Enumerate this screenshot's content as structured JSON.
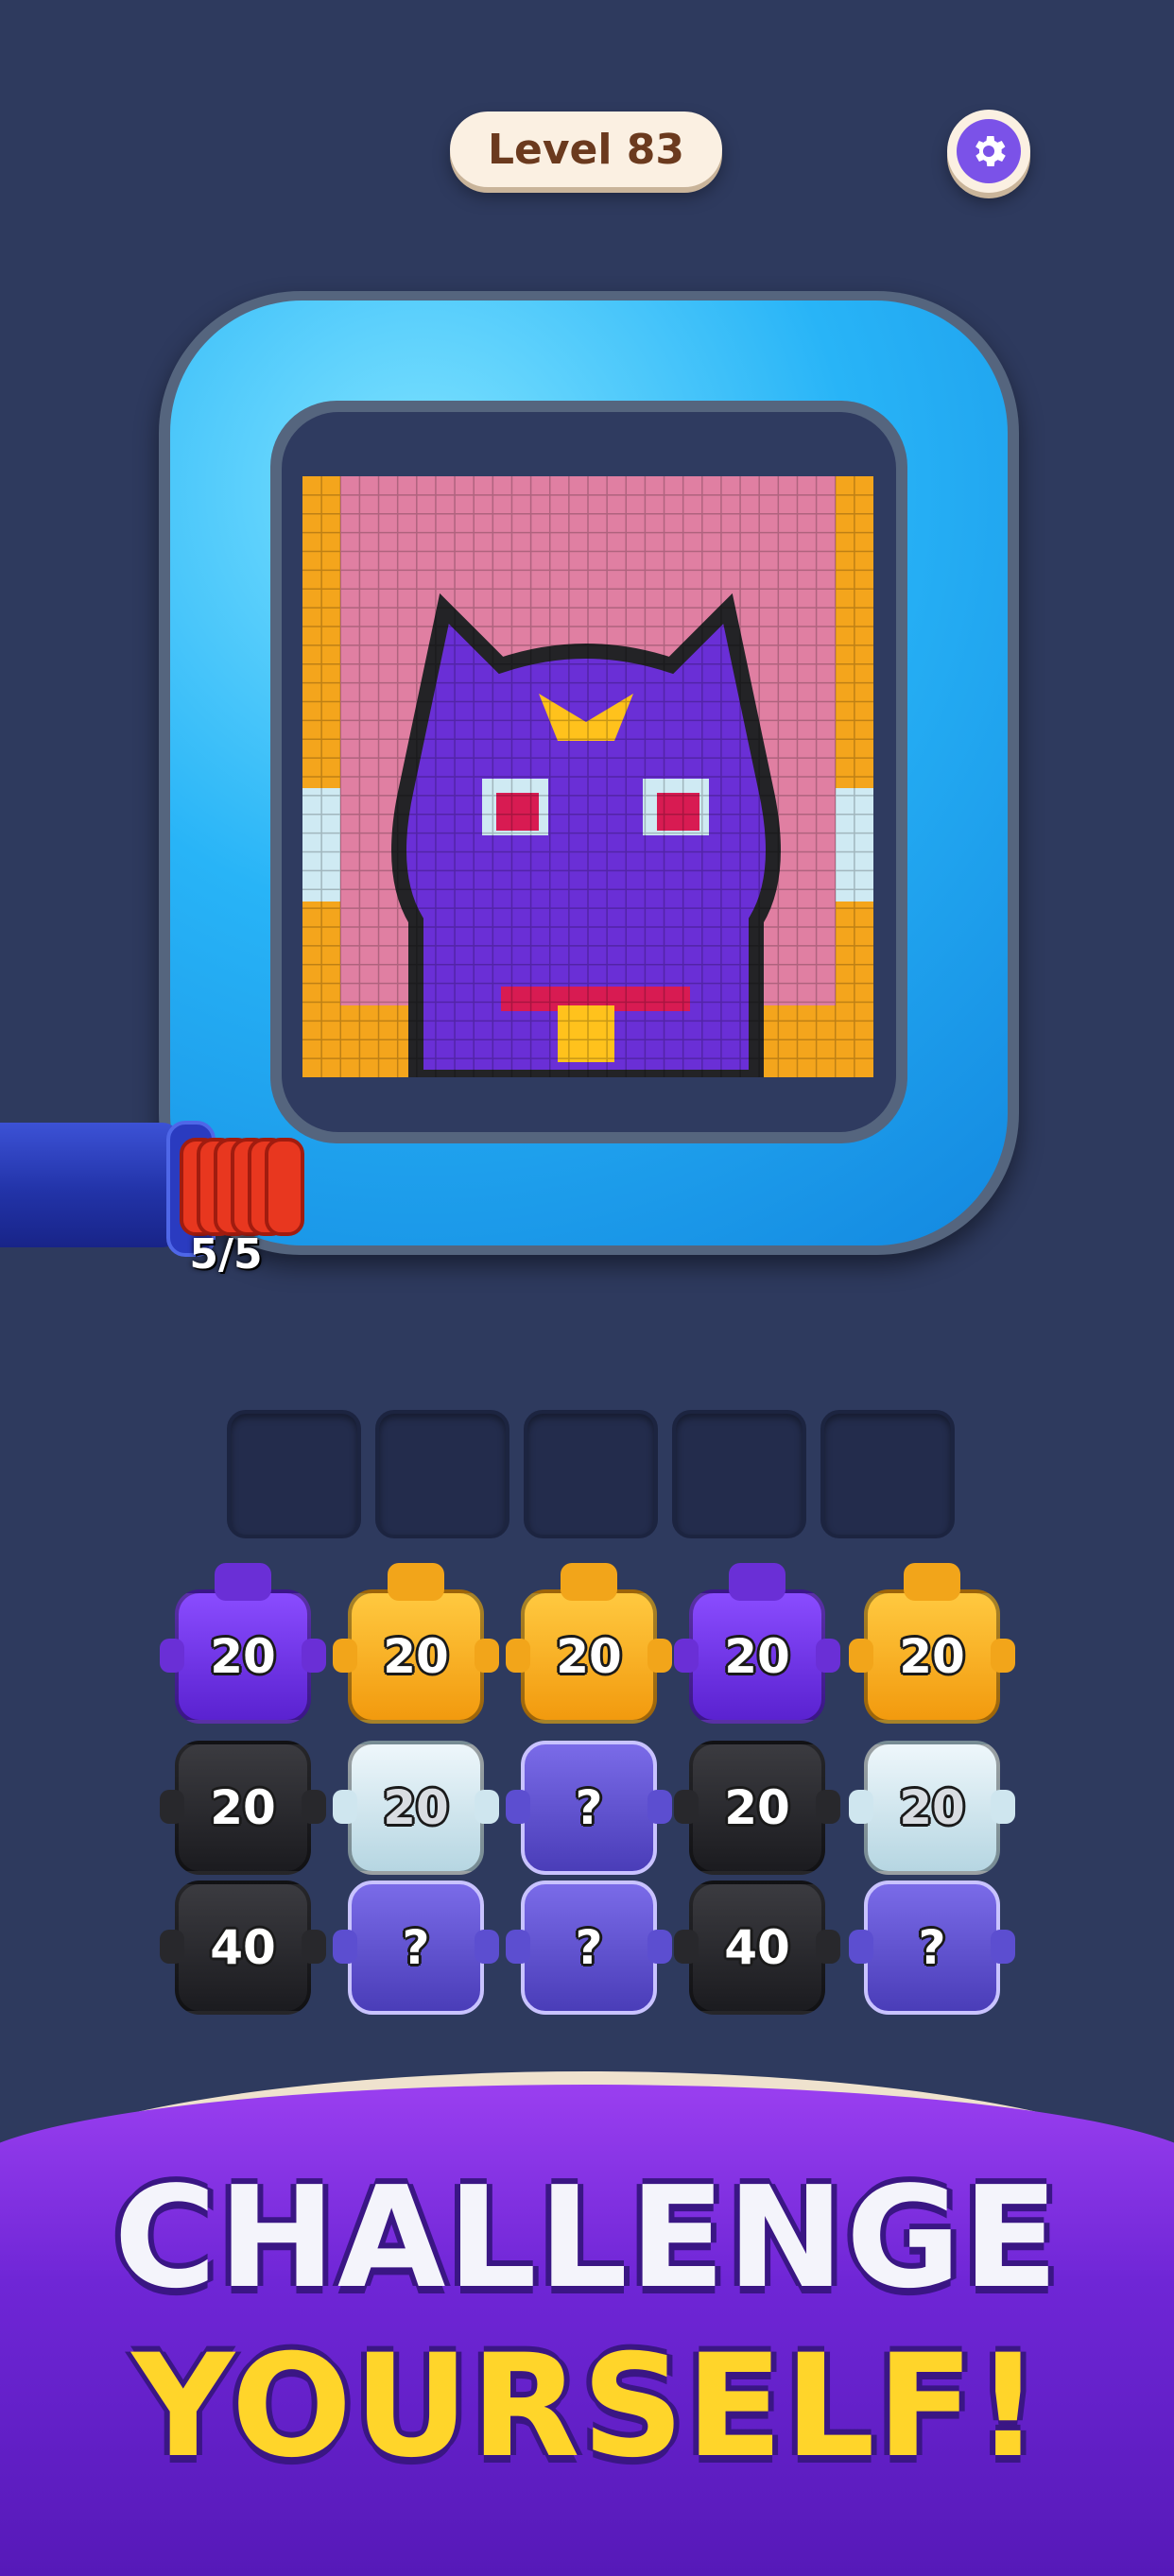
{
  "header": {
    "level_label": "Level 83",
    "settings_icon": "gear-icon"
  },
  "shooter": {
    "ammo_count": "5/5",
    "ammo_color": "#e8371f"
  },
  "slots": {
    "count": 5
  },
  "blocks": [
    {
      "label": "20",
      "color": "purple",
      "hidden": false
    },
    {
      "label": "20",
      "color": "yellow",
      "hidden": false
    },
    {
      "label": "20",
      "color": "yellow",
      "hidden": false
    },
    {
      "label": "20",
      "color": "purple",
      "hidden": false
    },
    {
      "label": "20",
      "color": "yellow",
      "hidden": false
    },
    {
      "label": "20",
      "color": "black",
      "hidden": false
    },
    {
      "label": "20",
      "color": "white",
      "hidden": false
    },
    {
      "label": "?",
      "color": "mystery",
      "hidden": true
    },
    {
      "label": "20",
      "color": "black",
      "hidden": false
    },
    {
      "label": "20",
      "color": "white",
      "hidden": false
    },
    {
      "label": "40",
      "color": "black",
      "hidden": false
    },
    {
      "label": "?",
      "color": "mystery",
      "hidden": true
    },
    {
      "label": "?",
      "color": "mystery",
      "hidden": true
    },
    {
      "label": "40",
      "color": "black",
      "hidden": false
    },
    {
      "label": "?",
      "color": "mystery",
      "hidden": true
    }
  ],
  "banner": {
    "line1": "CHALLENGE",
    "line2": "YOURSELF!"
  },
  "palette": {
    "orange": "#f4a51c",
    "pink": "#e07fa2",
    "purple": "#6a2fd6",
    "dark": "#232326",
    "light": "#cfeaf3",
    "yellow": "#ffc21c",
    "red": "#d81b52"
  }
}
